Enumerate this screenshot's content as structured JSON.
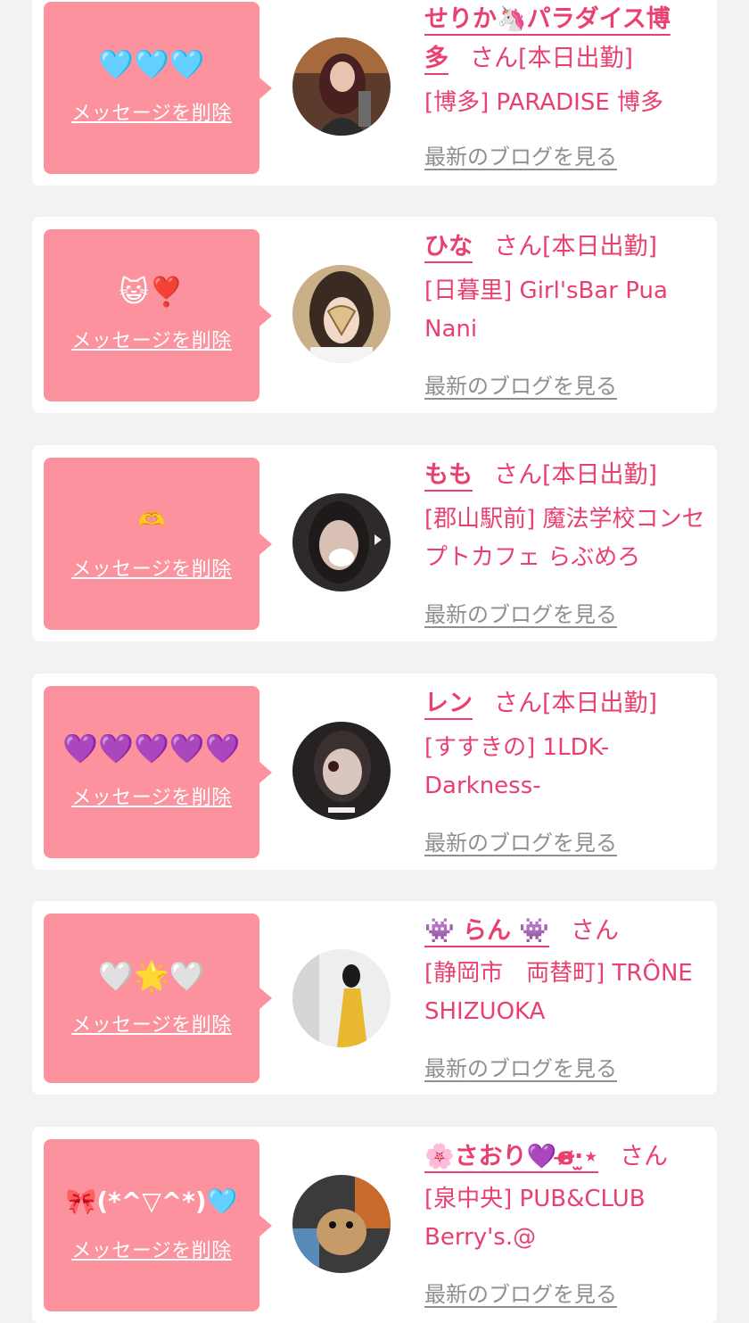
{
  "cards": [
    {
      "emoji": "🩵🩵🩵",
      "delete_label": "メッセージを削除",
      "name": "せりか🦄パラダイス博多",
      "suffix": "さん",
      "status": "[本日出勤]",
      "shop": "[博多] PARADISE 博多",
      "blog_label": "最新のブログを見る"
    },
    {
      "emoji": "😺❣️",
      "delete_label": "メッセージを削除",
      "name": "ひな",
      "suffix": "さん",
      "status": "[本日出勤]",
      "shop": "[日暮里] Girl'sBar Pua Nani",
      "blog_label": "最新のブログを見る"
    },
    {
      "emoji": "🫶",
      "delete_label": "メッセージを削除",
      "name": "もも",
      "suffix": "さん",
      "status": "[本日出勤]",
      "shop": "[郡山駅前] 魔法学校コンセプトカフェ らぶめろ",
      "blog_label": "最新のブログを見る"
    },
    {
      "emoji": "💜💜💜💜💜",
      "delete_label": "メッセージを削除",
      "name": "レン",
      "suffix": "さん",
      "status": "[本日出勤]",
      "shop": "[すすきの] 1LDK-Darkness-",
      "blog_label": "最新のブログを見る"
    },
    {
      "emoji": "🤍🌟🤍",
      "delete_label": "メッセージを削除",
      "name": "👾 らん 👾",
      "suffix": "さん",
      "status": "",
      "shop": "[静岡市　両替町] TRÔNE SHIZUOKA",
      "blog_label": "最新のブログを見る"
    },
    {
      "emoji": "🎀(*^▽^*)🩵",
      "delete_label": "メッセージを削除",
      "name": "🌸さおり💜ɞ̴̶̷·̫⋆",
      "suffix": "さん",
      "status": "",
      "shop": "[泉中央] PUB&CLUB Berry's.@",
      "blog_label": "最新のブログを見る"
    }
  ],
  "colors": {
    "background": "#f2f2f2",
    "card": "#ffffff",
    "bubble": "#fc929d",
    "name_pink": "#e94070",
    "blog_gray": "#8f8f8f"
  }
}
